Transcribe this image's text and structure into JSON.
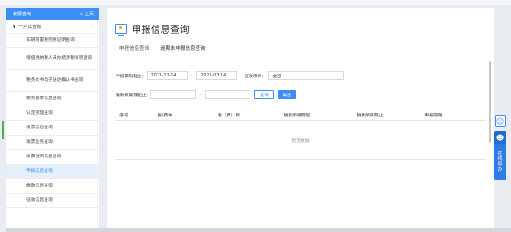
{
  "sidebar": {
    "header_title": "我要查询",
    "home_label": "主页",
    "group_label": "一户式查询",
    "items": [
      {
        "label": "车辆购置税完税证明查询",
        "lines": 1
      },
      {
        "label": "增值税纳税人未办结涉税事项查询",
        "lines": 2
      },
      {
        "label": "税务文书电子送达确认书查询",
        "lines": 2
      },
      {
        "label": "税务基本信息查询",
        "lines": 1
      },
      {
        "label": "认定管理查询",
        "lines": 1
      },
      {
        "label": "发票信息查询",
        "lines": 1
      },
      {
        "label": "发票业务查询",
        "lines": 1
      },
      {
        "label": "发票领购信息查询",
        "lines": 1
      },
      {
        "label": "申报信息查询",
        "lines": 1,
        "active": true
      },
      {
        "label": "缴款信息查询",
        "lines": 1
      },
      {
        "label": "征收信息查询",
        "lines": 1
      }
    ]
  },
  "main": {
    "title": "申报信息查询",
    "tabs": [
      {
        "label": "申报信息查询",
        "active": false
      },
      {
        "label": "逾期未申报信息查询",
        "active": true
      }
    ],
    "filters": {
      "period_label": "申报期限起止：",
      "period_start": "2021-12-14",
      "period_end": "2022-03-14",
      "dash": "-",
      "levy_label": "征收项目：",
      "levy_value": "全部",
      "tax_period_label": "税款所属期起止：",
      "query_button": "查询",
      "export_button": "导出"
    },
    "table": {
      "columns": [
        "序号",
        "税/费种",
        "税（费）目",
        "税款所属期起",
        "税款所属期止",
        "申报期限"
      ],
      "empty_text": "暂无数据"
    }
  },
  "float_panel": {
    "user_icon": "user-icon",
    "online_label": [
      "在",
      "线",
      "导",
      "办"
    ]
  },
  "colors": {
    "accent": "#3e8ef7",
    "sidebar_header": "#3e8ef7",
    "active_item_bg": "#e6f0fd"
  }
}
